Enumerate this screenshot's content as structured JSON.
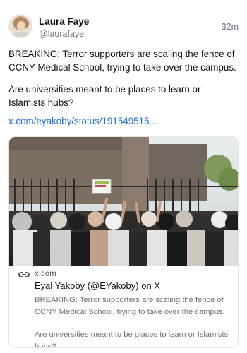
{
  "post": {
    "author_name": "Laura Faye",
    "author_handle": "@laurafaye",
    "time": "32m",
    "paragraph_1": "BREAKING: Terror supporters are scaling the fence of CCNY Medical School, trying to take over the campus.",
    "paragraph_2": "Are universities meant to be places to learn or Islamists hubs?",
    "link_text": "x.com/eyakoby/status/191549515..."
  },
  "card": {
    "domain": "x.com",
    "title": "Eyal Yakoby (@EYakoby) on X",
    "description_1": "BREAKING: Terror supporters are scaling the fence of CCNY Medical School, trying to take over the campus.",
    "description_2": "Are universities meant to be places to learn or Islamists hubs?"
  },
  "icons": {
    "link": "link-icon",
    "avatar": "avatar-photo"
  },
  "colors": {
    "link": "#1d70d9",
    "muted": "#6b7280",
    "card_border": "#e3e3e3"
  }
}
